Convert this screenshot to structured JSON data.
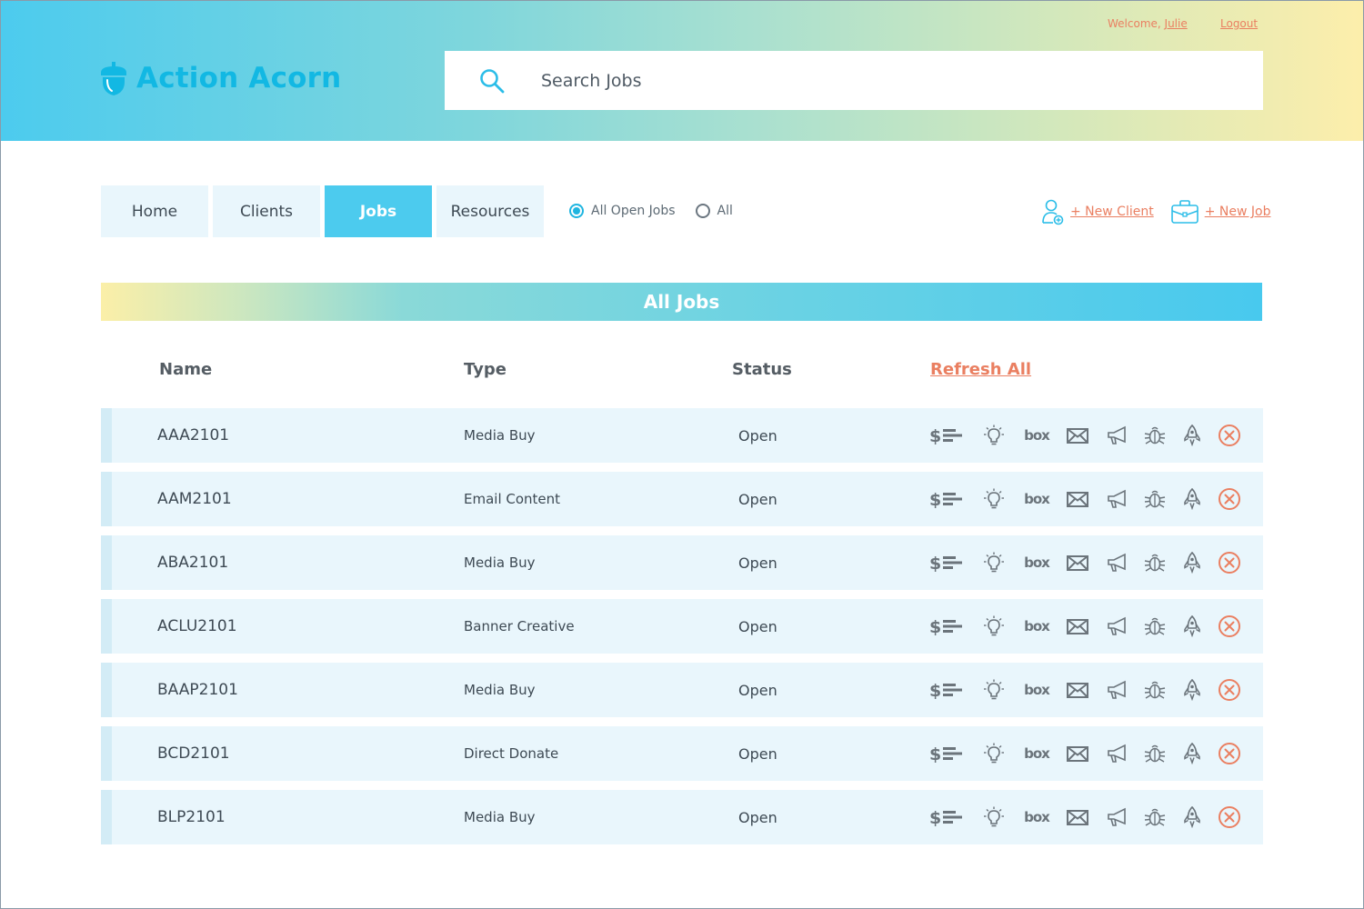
{
  "app": {
    "name": "Action Acorn",
    "brand_color": "#12b8e3",
    "accent_color": "#ea7f61",
    "active_tab_color": "#4ccbee"
  },
  "header": {
    "welcome_prefix": "Welcome, ",
    "user_name": "Julie",
    "logout_label": "Logout",
    "search": {
      "placeholder": "Search Jobs",
      "value": ""
    }
  },
  "nav": {
    "tabs": [
      {
        "label": "Home",
        "active": false
      },
      {
        "label": "Clients",
        "active": false
      },
      {
        "label": "Jobs",
        "active": true
      },
      {
        "label": "Resources",
        "active": false
      }
    ],
    "filters": [
      {
        "label": "All Open Jobs",
        "checked": true
      },
      {
        "label": "All",
        "checked": false
      }
    ],
    "new_client_label": "+ New Client",
    "new_job_label": "+ New Job"
  },
  "jobs": {
    "title": "All Jobs",
    "columns": {
      "name": "Name",
      "type": "Type",
      "status": "Status",
      "refresh": "Refresh All"
    },
    "row_actions": [
      "billing-icon",
      "idea-icon",
      "box-icon",
      "mail-icon",
      "megaphone-icon",
      "bug-icon",
      "rocket-icon",
      "delete-icon"
    ],
    "box_icon_text": "box",
    "rows": [
      {
        "name": "AAA2101",
        "type": "Media Buy",
        "status": "Open"
      },
      {
        "name": "AAM2101",
        "type": "Email Content",
        "status": "Open"
      },
      {
        "name": "ABA2101",
        "type": "Media Buy",
        "status": "Open"
      },
      {
        "name": "ACLU2101",
        "type": "Banner Creative",
        "status": "Open"
      },
      {
        "name": "BAAP2101",
        "type": "Media Buy",
        "status": "Open"
      },
      {
        "name": "BCD2101",
        "type": "Direct Donate",
        "status": "Open"
      },
      {
        "name": "BLP2101",
        "type": "Media Buy",
        "status": "Open"
      }
    ]
  }
}
